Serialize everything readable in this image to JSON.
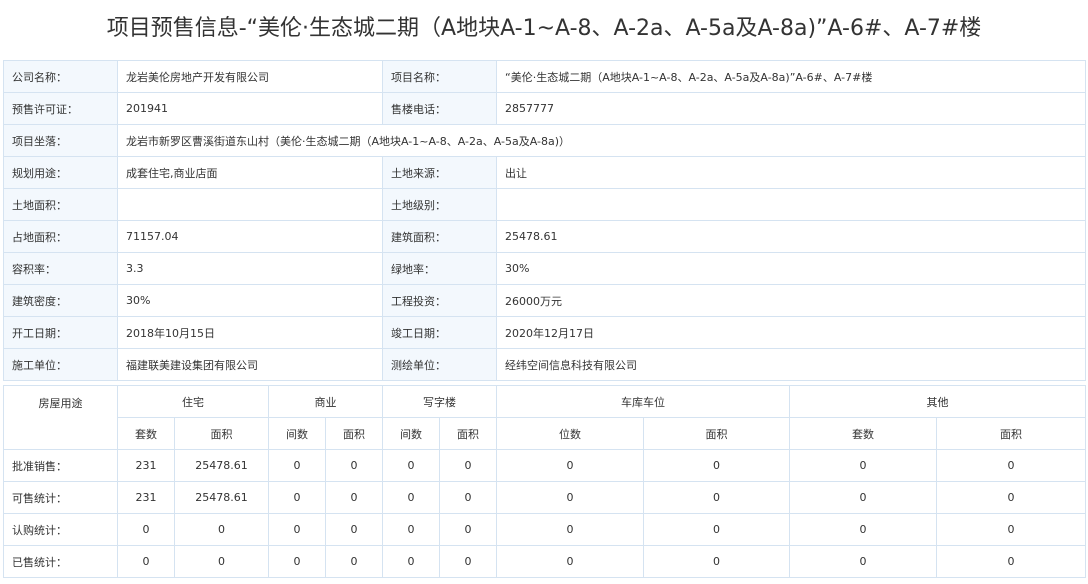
{
  "title": "项目预售信息-“美伦·生态城二期（A地块A-1~A-8、A-2a、A-5a及A-8a)”A-6#、A-7#楼",
  "info_rows": [
    [
      {
        "label": "公司名称：",
        "value": "龙岩美伦房地产开发有限公司"
      },
      {
        "label": "项目名称：",
        "value": "“美伦·生态城二期（A地块A-1~A-8、A-2a、A-5a及A-8a)”A-6#、A-7#楼"
      }
    ],
    [
      {
        "label": "预售许可证：",
        "value": "201941"
      },
      {
        "label": "售楼电话：",
        "value": "2857777"
      }
    ],
    [
      {
        "label": "项目坐落：",
        "value": "龙岩市新罗区曹溪街道东山村（美伦·生态城二期（A地块A-1~A-8、A-2a、A-5a及A-8a)）"
      }
    ],
    [
      {
        "label": "规划用途：",
        "value": "成套住宅,商业店面"
      },
      {
        "label": "土地来源：",
        "value": "出让"
      }
    ],
    [
      {
        "label": "土地面积：",
        "value": ""
      },
      {
        "label": "土地级别：",
        "value": ""
      }
    ],
    [
      {
        "label": "占地面积：",
        "value": "71157.04"
      },
      {
        "label": "建筑面积：",
        "value": "25478.61"
      }
    ],
    [
      {
        "label": "容积率：",
        "value": "3.3"
      },
      {
        "label": "绿地率：",
        "value": "30%"
      }
    ],
    [
      {
        "label": "建筑密度：",
        "value": "30%"
      },
      {
        "label": "工程投资：",
        "value": "26000万元"
      }
    ],
    [
      {
        "label": "开工日期：",
        "value": "2018年10月15日"
      },
      {
        "label": "竣工日期：",
        "value": "2020年12月17日"
      }
    ],
    [
      {
        "label": "施工单位：",
        "value": "福建联美建设集团有限公司"
      },
      {
        "label": "测绘单位：",
        "value": "经纬空间信息科技有限公司"
      }
    ]
  ],
  "stats": {
    "corner_label": "房屋用途",
    "groups": [
      {
        "name": "住宅",
        "subs": [
          "套数",
          "面积"
        ]
      },
      {
        "name": "商业",
        "subs": [
          "间数",
          "面积"
        ]
      },
      {
        "name": "写字楼",
        "subs": [
          "间数",
          "面积"
        ]
      },
      {
        "name": "车库车位",
        "subs": [
          "位数",
          "面积"
        ]
      },
      {
        "name": "其他",
        "subs": [
          "套数",
          "面积"
        ]
      }
    ],
    "rows": [
      {
        "label": "批准销售：",
        "values": [
          "231",
          "25478.61",
          "0",
          "0",
          "0",
          "0",
          "0",
          "0",
          "0",
          "0"
        ]
      },
      {
        "label": "可售统计：",
        "values": [
          "231",
          "25478.61",
          "0",
          "0",
          "0",
          "0",
          "0",
          "0",
          "0",
          "0"
        ]
      },
      {
        "label": "认购统计：",
        "values": [
          "0",
          "0",
          "0",
          "0",
          "0",
          "0",
          "0",
          "0",
          "0",
          "0"
        ]
      },
      {
        "label": "已售统计：",
        "values": [
          "0",
          "0",
          "0",
          "0",
          "0",
          "0",
          "0",
          "0",
          "0",
          "0"
        ]
      }
    ]
  }
}
